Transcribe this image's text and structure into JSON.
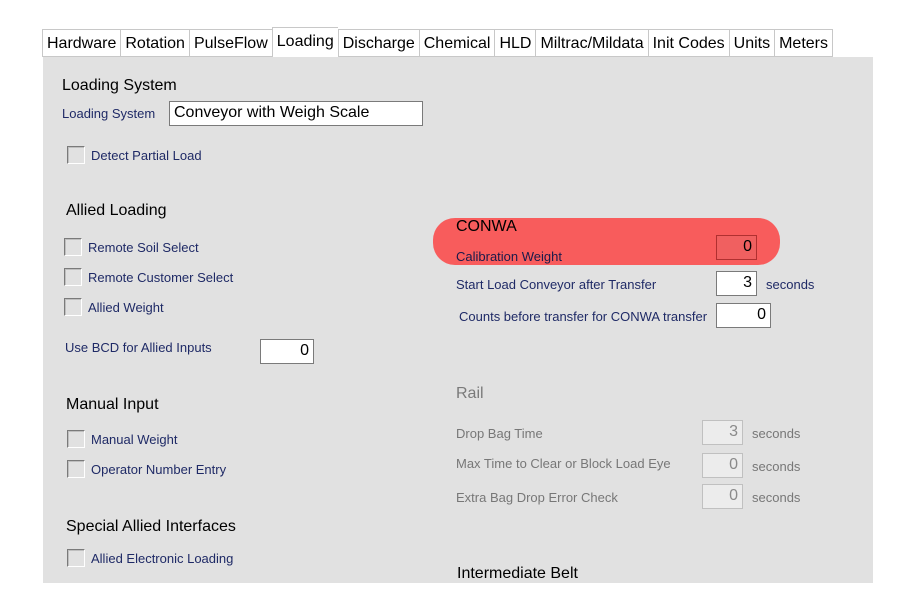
{
  "tabs": [
    "Hardware",
    "Rotation",
    "PulseFlow",
    "Loading",
    "Discharge",
    "Chemical",
    "HLD",
    "Miltrac/Mildata",
    "Init Codes",
    "Units",
    "Meters"
  ],
  "active_tab": "Loading",
  "colors": {
    "panel": "#e1e1e1",
    "highlight": "#f85c5c",
    "label": "#1f2a66"
  },
  "loading_system": {
    "title": "Loading System",
    "field_label": "Loading System",
    "field_value": "Conveyor with Weigh Scale",
    "detect_partial_load": "Detect Partial Load"
  },
  "allied_loading": {
    "title": "Allied Loading",
    "remote_soil_select": "Remote Soil Select",
    "remote_customer_select": "Remote Customer Select",
    "allied_weight": "Allied Weight",
    "bcd_label": "Use BCD for Allied Inputs",
    "bcd_value": "0"
  },
  "manual_input": {
    "title": "Manual Input",
    "manual_weight": "Manual Weight",
    "operator_number_entry": "Operator Number Entry"
  },
  "special_allied": {
    "title": "Special Allied Interfaces",
    "allied_electronic_loading": "Allied Electronic Loading"
  },
  "conwa": {
    "title": "CONWA",
    "calibration_weight_label": "Calibration Weight",
    "calibration_weight_value": "0",
    "start_load_label": "Start Load Conveyor after Transfer",
    "start_load_value": "3",
    "start_load_units": "seconds",
    "counts_label": "Counts before transfer for CONWA transfer",
    "counts_value": "0"
  },
  "rail": {
    "title": "Rail",
    "drop_bag_label": "Drop Bag Time",
    "drop_bag_value": "3",
    "drop_bag_units": "seconds",
    "max_time_label": "Max Time to Clear or Block Load Eye",
    "max_time_value": "0",
    "max_time_units": "seconds",
    "extra_bag_label": "Extra Bag Drop Error Check",
    "extra_bag_value": "0",
    "extra_bag_units": "seconds"
  },
  "intermediate_belt": {
    "title": "Intermediate Belt"
  }
}
